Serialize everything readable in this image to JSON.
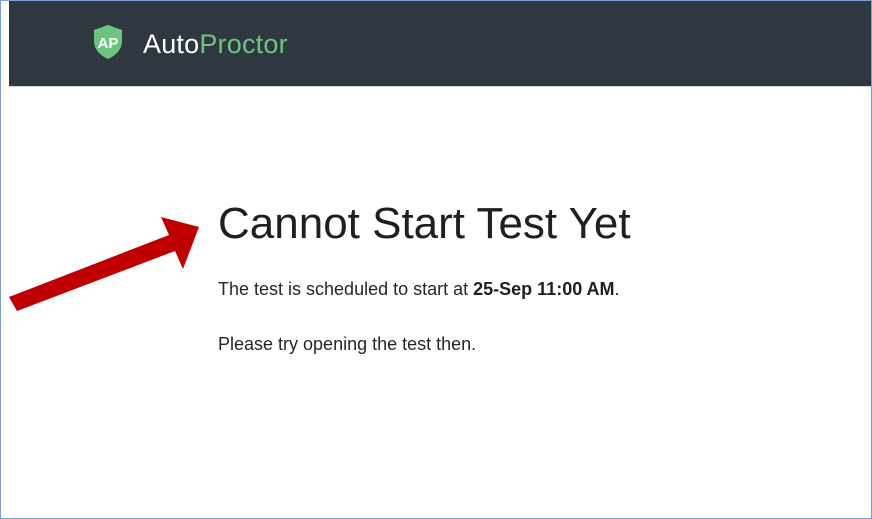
{
  "header": {
    "logo_text": "AP",
    "brand_part1": "Auto",
    "brand_part2": "Proctor",
    "brand_colors": {
      "auto": "#ffffff",
      "proctor": "#6cc47e",
      "bar": "#2f3841"
    }
  },
  "main": {
    "title": "Cannot Start Test Yet",
    "schedule_prefix": "The test is scheduled to start at ",
    "schedule_time": "25-Sep 11:00 AM",
    "schedule_suffix": ".",
    "instruction": "Please try opening the test then."
  },
  "annotation": {
    "arrow_icon": "red-arrow-icon",
    "arrow_color": "#c00000"
  }
}
